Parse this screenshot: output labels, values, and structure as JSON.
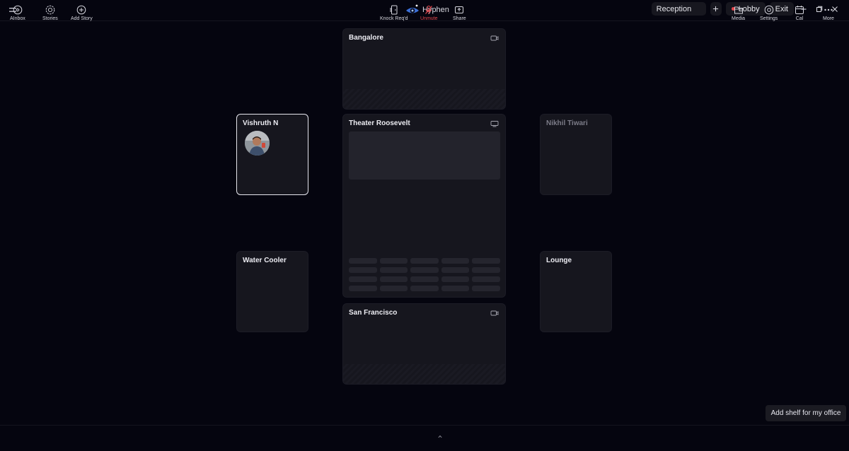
{
  "app": {
    "name": "Hyphen"
  },
  "header": {
    "reception_label": "Reception",
    "lobby_label": "Lobby",
    "exit_label": "Exit"
  },
  "rooms": {
    "bangalore": "Bangalore",
    "vishruth": "Vishruth N",
    "theater": "Theater Roosevelt",
    "nikhil": "Nikhil Tiwari",
    "water_cooler": "Water Cooler",
    "lounge": "Lounge",
    "san_francisco": "San Francisco"
  },
  "tooltip": "Add shelf for my office",
  "toolbar": {
    "ainbox": "AInbox",
    "stories": "Stories",
    "add_story": "Add Story",
    "knock": "Knock Req'd",
    "unmute": "Unmute",
    "share": "Share",
    "media": "Media",
    "settings": "Settings",
    "cal": "Cal",
    "more": "More"
  },
  "colors": {
    "background": "#05050f",
    "tile": "#16161e",
    "alert_red": "#e5484d"
  },
  "icons": [
    "menu-icon",
    "eye-logo-icon",
    "plus-icon",
    "minimize-icon",
    "maximize-icon",
    "close-icon",
    "camera-icon",
    "screen-icon",
    "ainbox-icon",
    "stories-icon",
    "add-story-icon",
    "knock-icon",
    "mic-muted-icon",
    "share-icon",
    "media-icon",
    "settings-icon",
    "calendar-icon",
    "more-icon"
  ]
}
